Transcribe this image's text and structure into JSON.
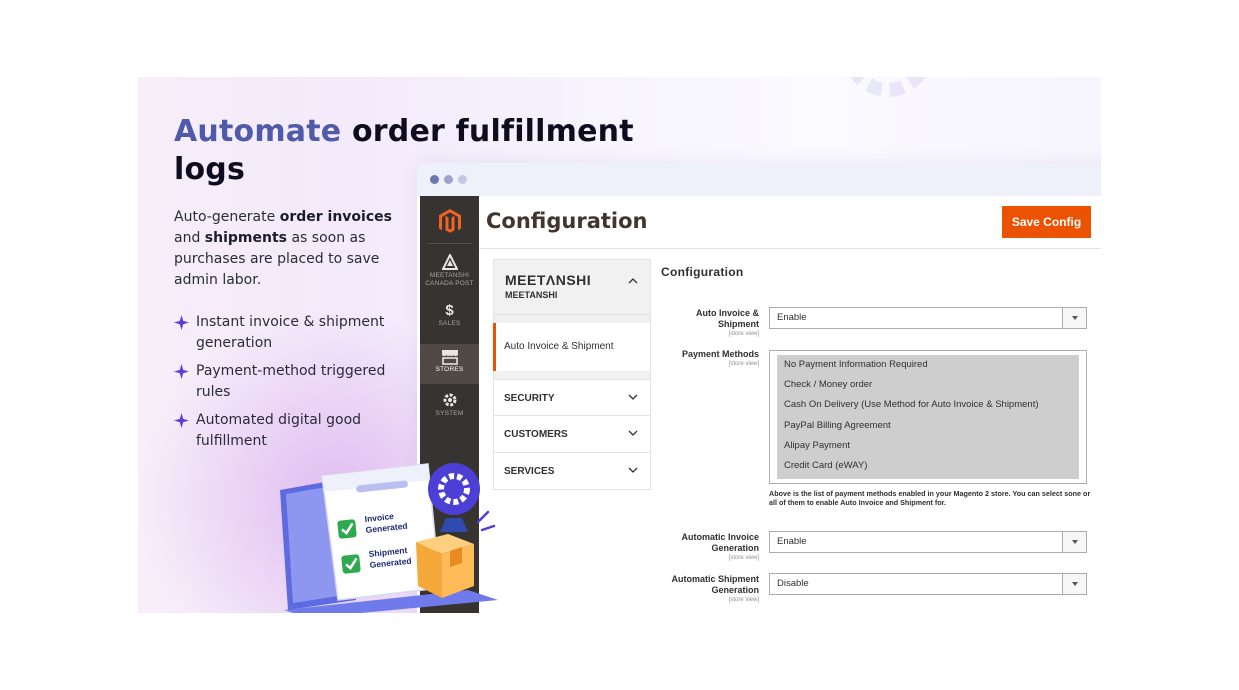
{
  "hero": {
    "headline_accent": "Automate",
    "headline_rest": "order fulfillment logs",
    "intro": {
      "p1": "Auto-generate ",
      "b1": "order invoices",
      "p2": " and ",
      "b2": "shipments",
      "p3": " as soon as purchases are placed to save admin labor."
    },
    "features": [
      "Instant invoice & shipment generation",
      "Payment-method triggered rules",
      "Automated digital good fulfillment"
    ],
    "illustration": {
      "label1": "Invoice",
      "label2": "Generated",
      "label3": "Shipment",
      "label4": "Generated"
    }
  },
  "admin": {
    "page_title": "Configuration",
    "save_button": "Save Config",
    "sidebar": [
      {
        "icon": "meetanshi-icon",
        "label1": "MEETANSHI",
        "label2": "CANADA POST"
      },
      {
        "icon": "dollar-icon",
        "glyph": "$",
        "label": "SALES"
      },
      {
        "icon": "store-icon",
        "label": "STORES"
      },
      {
        "icon": "gear-icon",
        "label": "SYSTEM"
      }
    ],
    "tabs": {
      "brand_logo": "MEETΛNSHI",
      "brand_name": "MEETANSHI",
      "active_item": "Auto Invoice & Shipment",
      "sections": [
        "SECURITY",
        "CUSTOMERS",
        "SERVICES"
      ]
    },
    "form": {
      "section_title": "Configuration",
      "scope": "[store view]",
      "fields": [
        {
          "label1": "Auto Invoice &",
          "label2": "Shipment",
          "value": "Enable"
        },
        {
          "label1": "Payment Methods"
        },
        {
          "label1": "Automatic Invoice",
          "label2": "Generation",
          "value": "Enable"
        },
        {
          "label1": "Automatic Shipment",
          "label2": "Generation",
          "value": "Disable"
        }
      ],
      "payment_methods": [
        "No Payment Information Required",
        "Check / Money order",
        "Cash On Delivery (Use Method for Auto Invoice & Shipment)",
        "PayPal Billing Agreement",
        "Alipay Payment",
        "Credit Card (eWAY)"
      ],
      "note": "Above is the list of payment methods enabled in your Magento 2 store. You can select sone or all of them to enable Auto Invoice and Shipment for."
    }
  },
  "colors": {
    "accent": "#4f5aa8",
    "save_button": "#eb5202",
    "sidebar": "#373330",
    "highlight_purple": "#6c3fe0"
  }
}
